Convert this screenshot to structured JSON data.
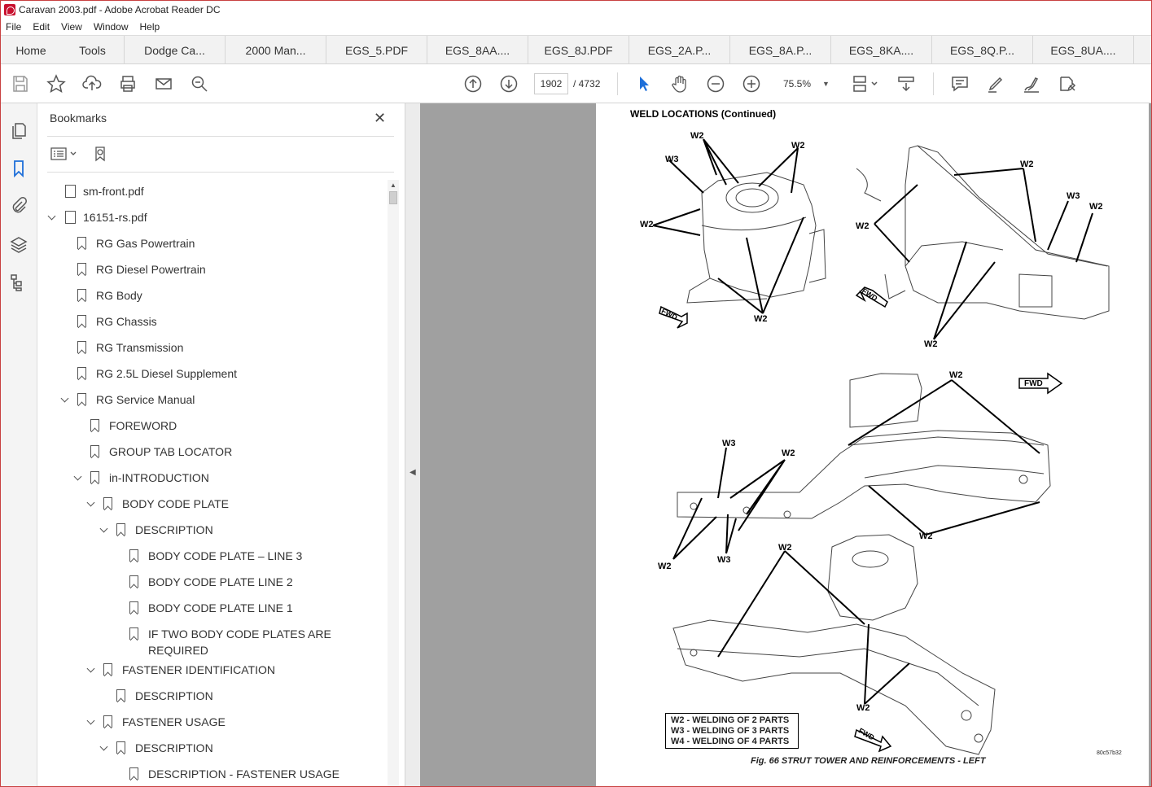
{
  "window": {
    "title": "Caravan 2003.pdf - Adobe Acrobat Reader DC"
  },
  "menu": [
    "File",
    "Edit",
    "View",
    "Window",
    "Help"
  ],
  "tabs": {
    "home": "Home",
    "tools": "Tools",
    "docs": [
      "Dodge Ca...",
      "2000 Man...",
      "EGS_5.PDF",
      "EGS_8AA....",
      "EGS_8J.PDF",
      "EGS_2A.P...",
      "EGS_8A.P...",
      "EGS_8KA....",
      "EGS_8Q.P...",
      "EGS_8UA...."
    ]
  },
  "toolbar": {
    "page_current": "1902",
    "page_total": "/ 4732",
    "zoom": "75.5%"
  },
  "bookmarks": {
    "title": "Bookmarks",
    "items": [
      {
        "label": "sm-front.pdf",
        "kind": "file"
      },
      {
        "label": "16151-rs.pdf",
        "kind": "file"
      },
      {
        "label": "RG Gas Powertrain"
      },
      {
        "label": "RG Diesel Powertrain"
      },
      {
        "label": "RG Body"
      },
      {
        "label": "RG Chassis"
      },
      {
        "label": "RG Transmission"
      },
      {
        "label": "RG 2.5L Diesel Supplement"
      },
      {
        "label": "RG Service Manual"
      },
      {
        "label": "FOREWORD"
      },
      {
        "label": "GROUP TAB LOCATOR"
      },
      {
        "label": "in-INTRODUCTION"
      },
      {
        "label": "BODY CODE PLATE"
      },
      {
        "label": "DESCRIPTION"
      },
      {
        "label": "BODY CODE PLATE – LINE 3"
      },
      {
        "label": "BODY CODE PLATE LINE 2"
      },
      {
        "label": "BODY CODE PLATE LINE 1"
      },
      {
        "label": "IF TWO BODY CODE PLATES ARE"
      },
      {
        "label": "REQUIRED"
      },
      {
        "label": "FASTENER IDENTIFICATION"
      },
      {
        "label": "DESCRIPTION"
      },
      {
        "label": "FASTENER USAGE"
      },
      {
        "label": "DESCRIPTION"
      },
      {
        "label": "DESCRIPTION - FASTENER USAGE"
      }
    ]
  },
  "document": {
    "heading": "WELD LOCATIONS (Continued)",
    "labels": {
      "w2": "W2",
      "w3": "W3",
      "fwd": "FWD"
    },
    "legend": [
      "W2 - WELDING OF 2 PARTS",
      "W3 - WELDING OF 3 PARTS",
      "W4 - WELDING OF 4 PARTS"
    ],
    "caption": "Fig. 66 STRUT TOWER AND REINFORCEMENTS - LEFT",
    "code": "80c57b32"
  }
}
